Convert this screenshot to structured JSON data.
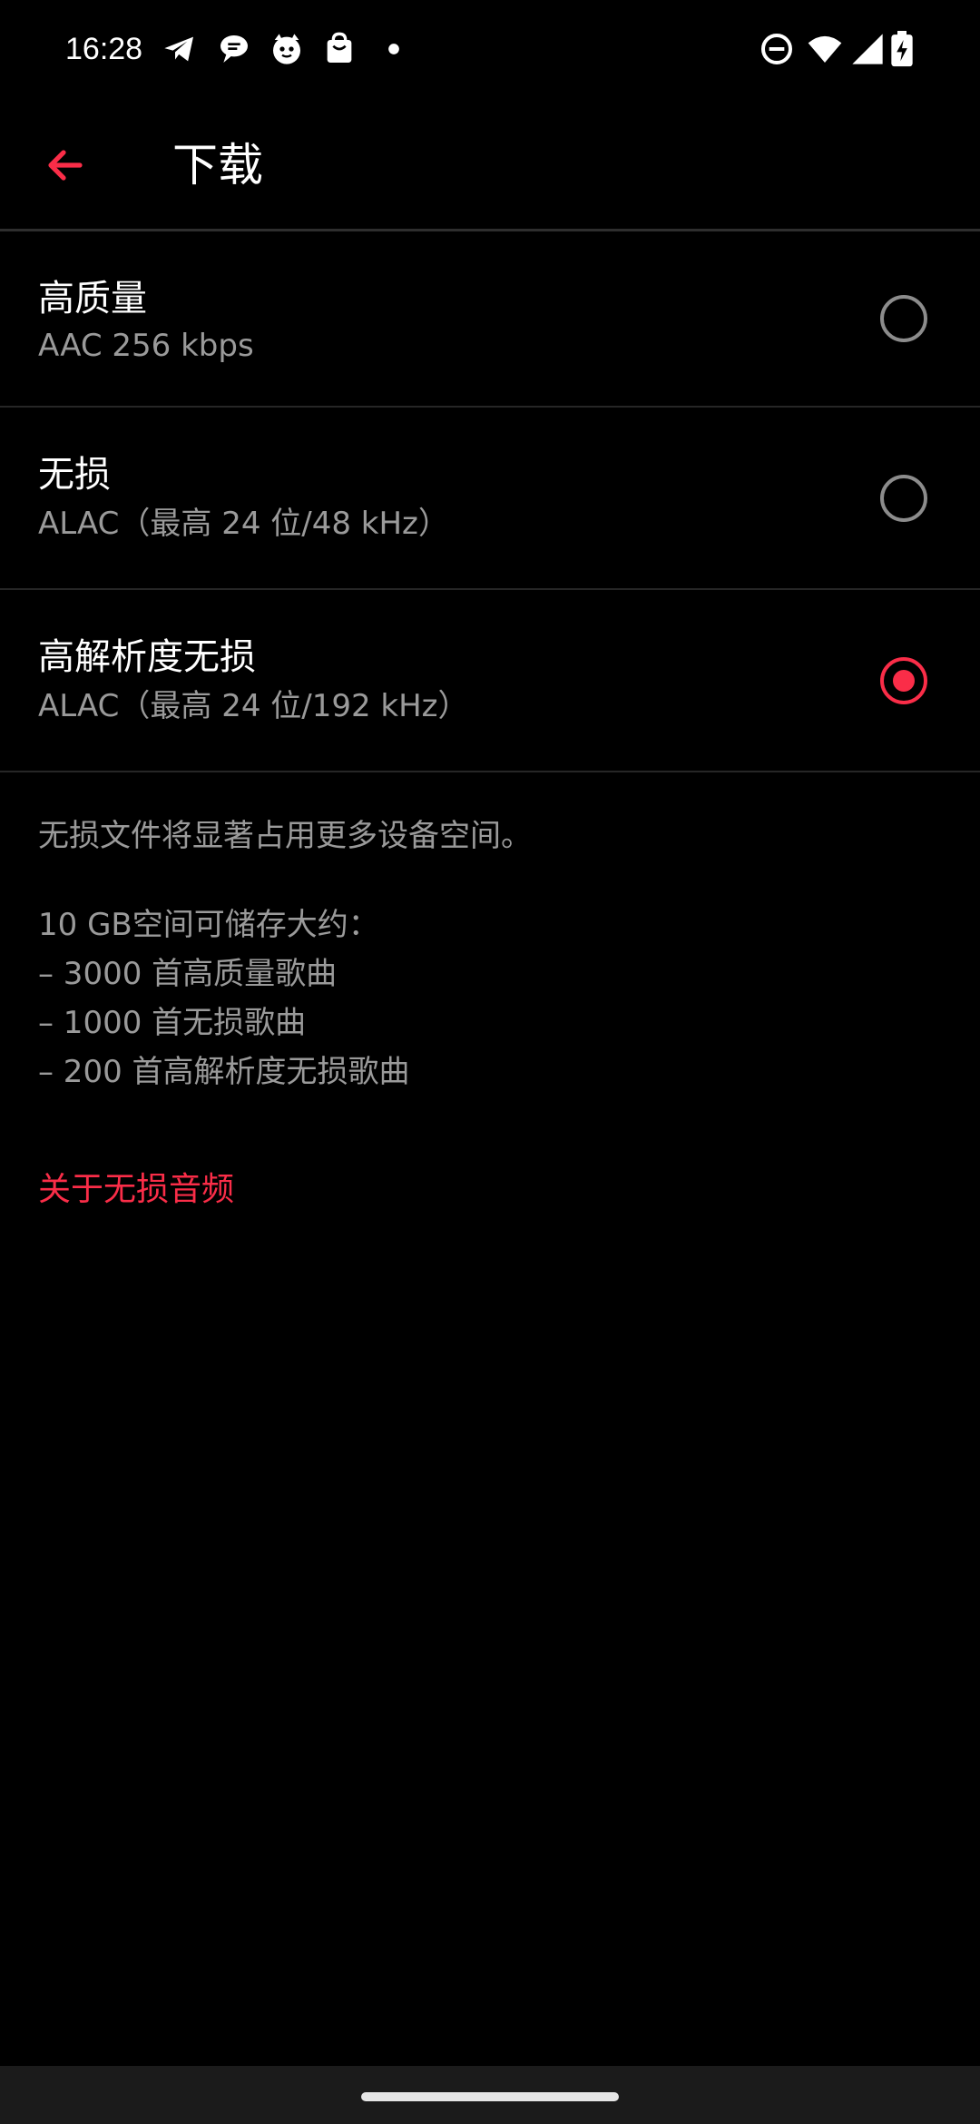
{
  "status_bar": {
    "time": "16:28",
    "left_icons": [
      "telegram-icon",
      "chat-bubble-icon",
      "cat-face-icon",
      "shopping-bag-icon",
      "notification-dot-icon"
    ],
    "right_icons": [
      "do-not-disturb-icon",
      "wifi-icon",
      "signal-icon",
      "battery-charging-icon"
    ]
  },
  "app_bar": {
    "back_icon": "arrow-back-icon",
    "title": "下载"
  },
  "colors": {
    "accent": "#fa2d48",
    "background": "#000000",
    "secondary_text": "#9a9a9a"
  },
  "options": [
    {
      "title": "高质量",
      "subtitle": "AAC 256 kbps",
      "selected": false
    },
    {
      "title": "无损",
      "subtitle": "ALAC（最高 24 位/48 kHz）",
      "selected": false
    },
    {
      "title": "高解析度无损",
      "subtitle": "ALAC（最高 24 位/192 kHz）",
      "selected": true
    }
  ],
  "info": {
    "note": "无损文件将显著占用更多设备空间。",
    "capacity_heading": "10 GB空间可储存大约：",
    "capacity_lines": [
      "– 3000 首高质量歌曲",
      "– 1000 首无损歌曲",
      "– 200 首高解析度无损歌曲"
    ]
  },
  "link": {
    "label": "关于无损音频"
  }
}
